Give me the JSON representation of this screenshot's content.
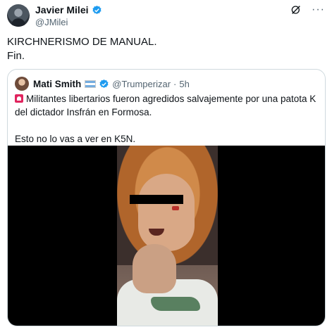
{
  "author": {
    "display_name": "Javier Milei",
    "handle": "@JMilei"
  },
  "tweet": {
    "line1": "KIRCHNERISMO DE MANUAL.",
    "line2": "Fin."
  },
  "quoted": {
    "display_name": "Mati Smith",
    "handle": "@Trumperizar",
    "separator": "·",
    "time": "5h",
    "text_line1": "Militantes libertarios fueron agredidos salvajemente por una patota K del dictador Insfrán en Formosa.",
    "text_line2": "Esto no lo vas a ver en K5N."
  },
  "icons": {
    "verified": "verified-badge-icon",
    "grok": "grok-icon",
    "more": "more-icon",
    "flag": "argentina-flag-icon",
    "siren": "siren-emoji-icon"
  },
  "colors": {
    "verified_blue": "#1d9bf0",
    "secondary_text": "#536471",
    "border": "#cfd9de"
  }
}
